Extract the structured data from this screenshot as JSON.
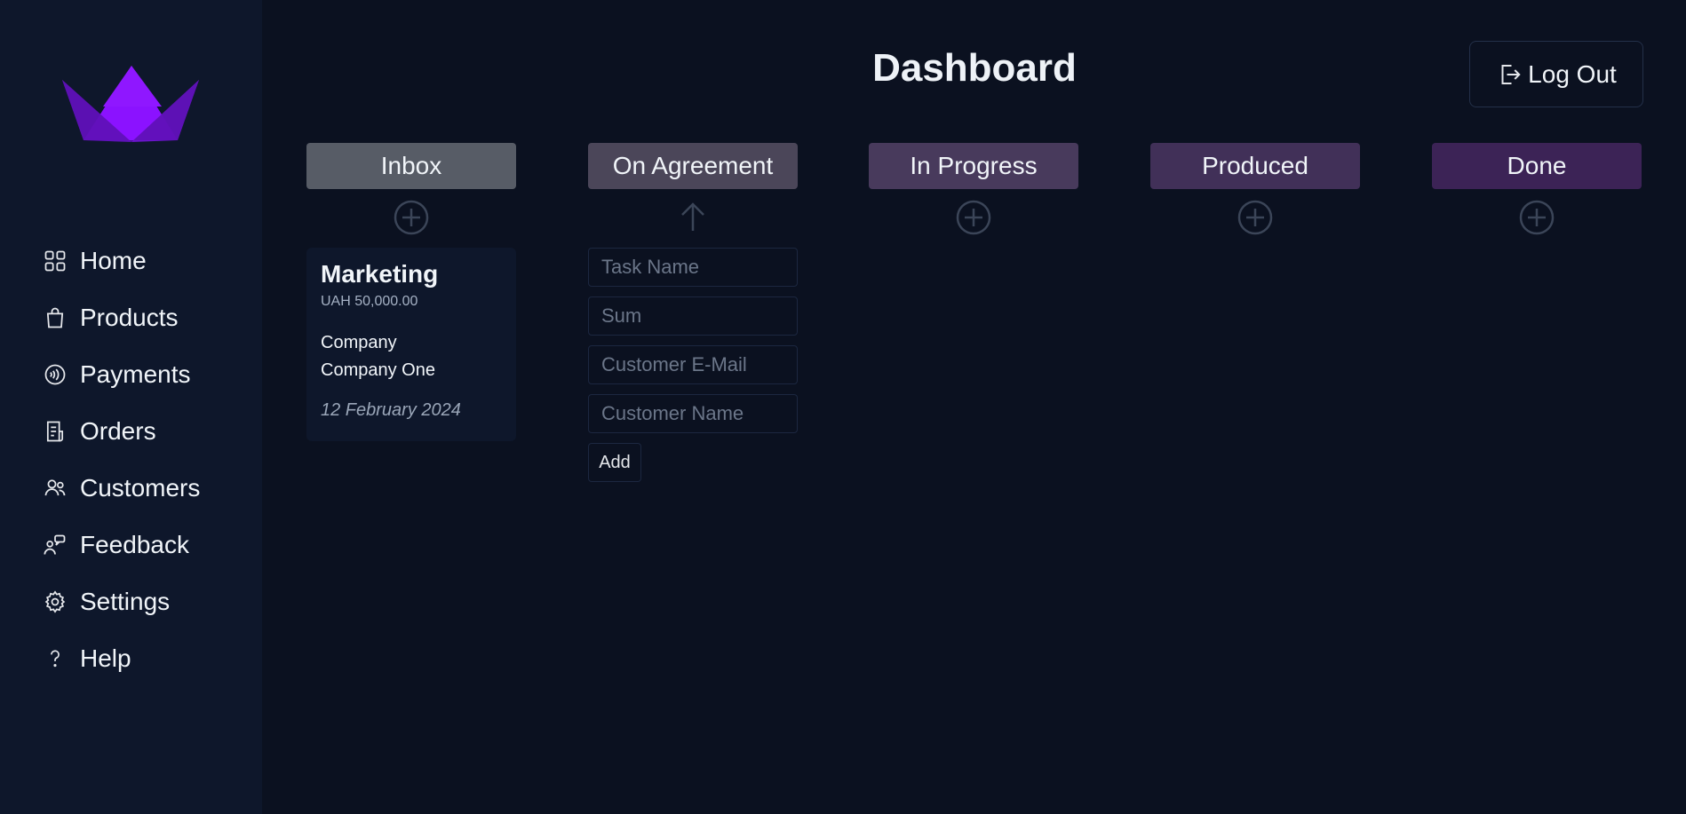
{
  "page": {
    "title": "Dashboard"
  },
  "header": {
    "logout_label": "Log Out"
  },
  "sidebar": {
    "items": [
      {
        "label": "Home",
        "icon": "grid-icon"
      },
      {
        "label": "Products",
        "icon": "shopping-bag-icon"
      },
      {
        "label": "Payments",
        "icon": "contactless-payment-icon"
      },
      {
        "label": "Orders",
        "icon": "receipt-icon"
      },
      {
        "label": "Customers",
        "icon": "users-icon"
      },
      {
        "label": "Feedback",
        "icon": "feedback-icon"
      },
      {
        "label": "Settings",
        "icon": "gear-icon"
      },
      {
        "label": "Help",
        "icon": "question-icon"
      }
    ]
  },
  "columns": [
    {
      "title": "Inbox",
      "color": "#575c66",
      "action": "plus-circle-icon"
    },
    {
      "title": "On Agreement",
      "color": "#4b4659",
      "action": "arrow-up-icon"
    },
    {
      "title": "In Progress",
      "color": "#483a5c",
      "action": "plus-circle-icon"
    },
    {
      "title": "Produced",
      "color": "#413058",
      "action": "plus-circle-icon"
    },
    {
      "title": "Done",
      "color": "#3c2356",
      "action": "plus-circle-icon"
    }
  ],
  "card": {
    "title": "Marketing",
    "sum": "UAH 50,000.00",
    "company_line1": "Company",
    "company_line2": "Company One",
    "date": "12 February 2024"
  },
  "form": {
    "task_name_placeholder": "Task Name",
    "sum_placeholder": "Sum",
    "email_placeholder": "Customer E-Mail",
    "customer_name_placeholder": "Customer Name",
    "add_label": "Add"
  },
  "colors": {
    "background": "#0b1120",
    "sidebar": "#0e172b",
    "brand": "#7c1ff0"
  }
}
